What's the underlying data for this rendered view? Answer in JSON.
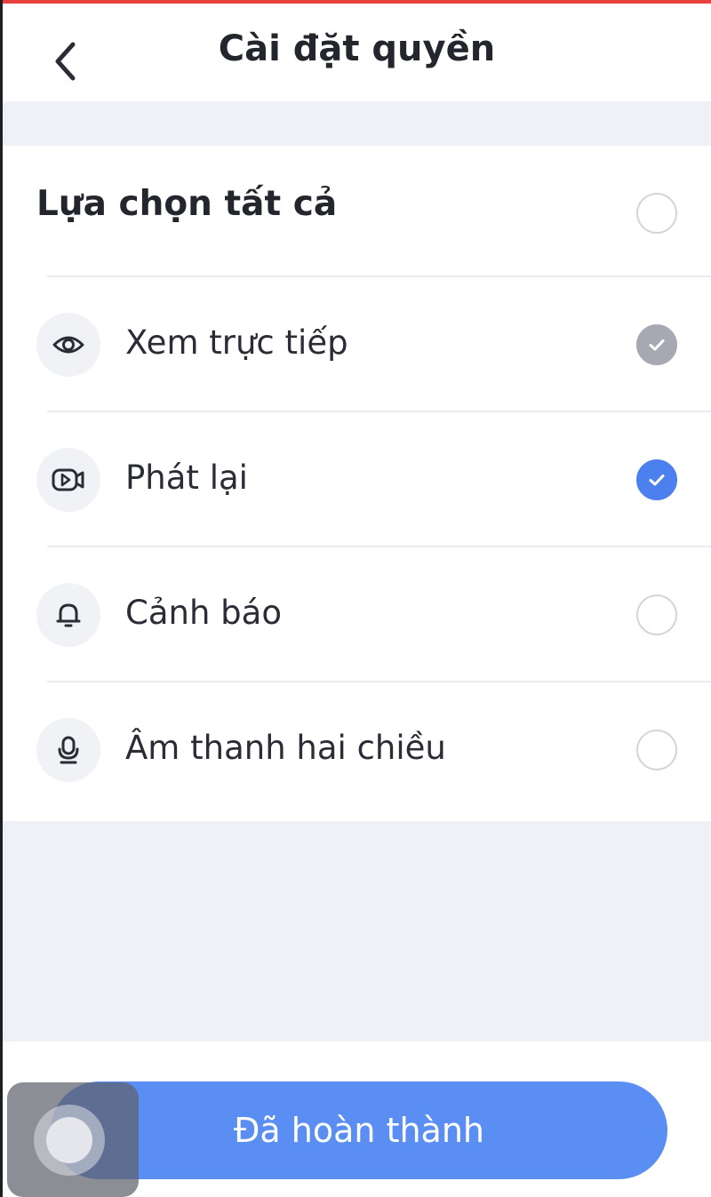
{
  "nav": {
    "title": "Cài đặt quyền",
    "back_icon": "chevron-left-icon"
  },
  "select_all": {
    "label": "Lựa chọn tất cả",
    "state": "unchecked"
  },
  "permissions": [
    {
      "label": "Xem trực tiếp",
      "icon": "eye-icon",
      "state": "checked-disabled"
    },
    {
      "label": "Phát lại",
      "icon": "video-playback-icon",
      "state": "checked"
    },
    {
      "label": "Cảnh báo",
      "icon": "bell-icon",
      "state": "unchecked"
    },
    {
      "label": "Âm thanh hai chiều",
      "icon": "microphone-icon",
      "state": "unchecked"
    }
  ],
  "footer": {
    "done_label": "Đã hoàn thành"
  },
  "colors": {
    "accent": "#4c80ee",
    "button": "#5a8ef2",
    "disabled_check": "#a6a9b1",
    "top_bar": "#e8403a",
    "background": "#eff1f6"
  }
}
